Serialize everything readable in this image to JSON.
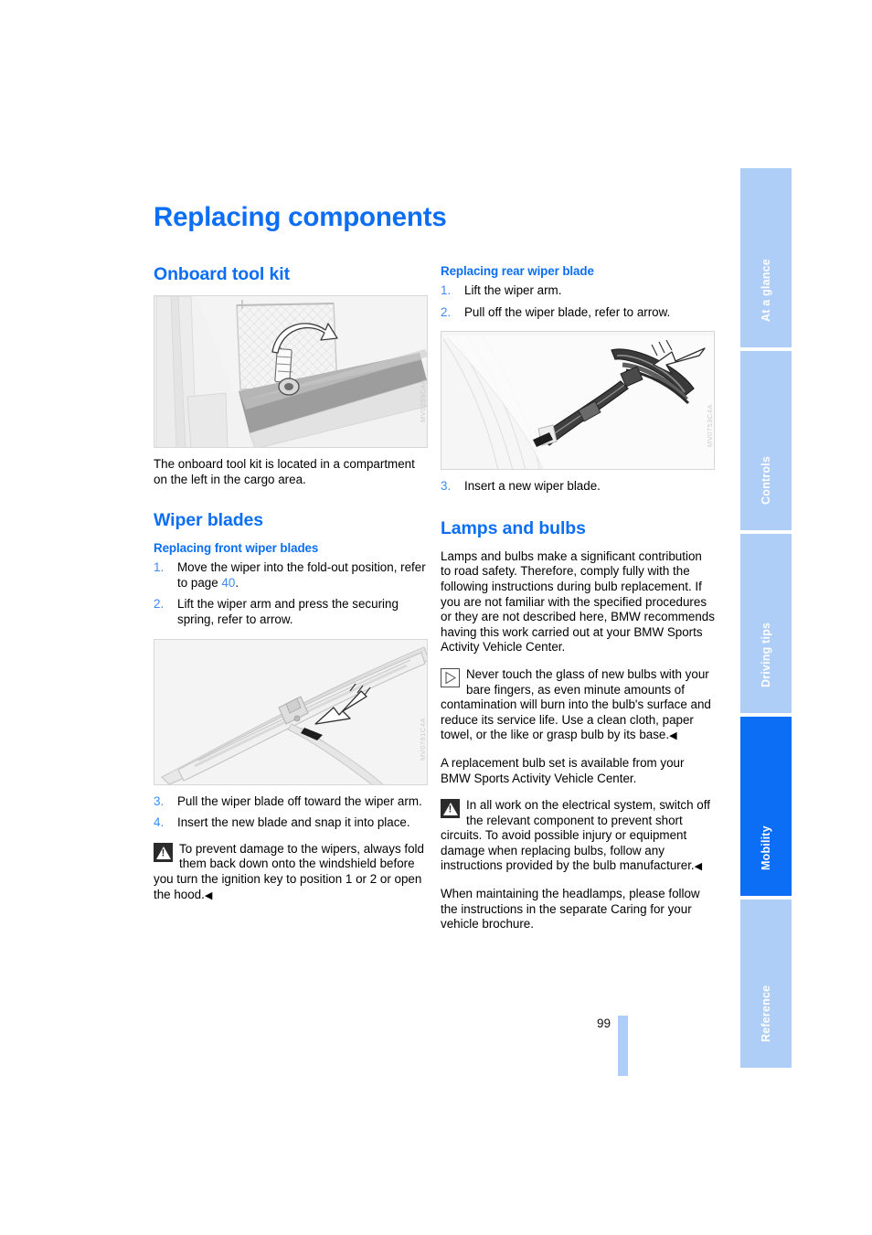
{
  "page": {
    "title": "Replacing components",
    "folio": "99",
    "accent_blue": "#0b6ef4",
    "tab_blue_inactive": "#aecdf7"
  },
  "sidebar": {
    "tabs": [
      {
        "label": "At a glance",
        "active": false
      },
      {
        "label": "Controls",
        "active": false
      },
      {
        "label": "Driving tips",
        "active": false
      },
      {
        "label": "Mobility",
        "active": true
      },
      {
        "label": "Reference",
        "active": false
      }
    ]
  },
  "left_column": {
    "section_tool_kit": {
      "heading": "Onboard tool kit",
      "figure_code": "MV0259C4A",
      "figure_alt": "cargo area left side compartment with strap and arrow",
      "body": "The onboard tool kit is located in a compartment on the left in the cargo area."
    },
    "section_wiper_blades": {
      "heading": "Wiper blades",
      "subheading": "Replacing front wiper blades",
      "steps_before": [
        {
          "num": "1.",
          "text_before": "Move the wiper into the fold-out position, refer to page ",
          "page_ref": "40",
          "text_after": "."
        },
        {
          "num": "2.",
          "text_before": "Lift the wiper arm and press the securing spring, refer to arrow.",
          "page_ref": "",
          "text_after": ""
        }
      ],
      "figure_code": "MV0781C4A",
      "figure_alt": "front wiper arm with blade and securing spring arrow",
      "steps_after": [
        {
          "num": "3.",
          "text": "Pull the wiper blade off toward the wiper arm."
        },
        {
          "num": "4.",
          "text": "Insert the new blade and snap it into place."
        }
      ],
      "warning": {
        "icon": "warning-triangle-icon",
        "text": "To prevent damage to the wipers, always fold them back down onto the windshield before you turn the ignition key to position 1 or 2 or open the hood.",
        "endmark": "◀"
      }
    }
  },
  "right_column": {
    "section_rear_wiper": {
      "subheading": "Replacing rear wiper blade",
      "steps_before": [
        {
          "num": "1.",
          "text": "Lift the wiper arm."
        },
        {
          "num": "2.",
          "text": "Pull off the wiper blade, refer to arrow."
        }
      ],
      "figure_code": "MV0753C4A",
      "figure_alt": "rear wiper blade being pulled off, arrow indicating direction",
      "steps_after": [
        {
          "num": "3.",
          "text": "Insert a new wiper blade."
        }
      ]
    },
    "section_lamps": {
      "heading": "Lamps and bulbs",
      "intro": "Lamps and bulbs make a significant contribution to road safety. Therefore, comply fully with the following instructions during bulb replacement. If you are not familiar with the specified procedures or they are not described here, BMW recommends having this work carried out at your BMW Sports Activity Vehicle Center.",
      "note": {
        "icon": "note-triangle-icon",
        "text": "Never touch the glass of new bulbs with your bare fingers, as even minute amounts of contamination will burn into the bulb's surface and reduce its service life. Use a clean cloth, paper towel, or the like or grasp bulb by its base.",
        "endmark": "◀"
      },
      "replacement_set": "A replacement bulb set is available from your BMW Sports Activity Vehicle Center.",
      "warning": {
        "icon": "warning-triangle-icon",
        "text": "In all work on the electrical system, switch off the relevant component to prevent short circuits. To avoid possible injury or equipment damage when replacing bulbs, follow any instructions provided by the bulb manufacturer.",
        "endmark": "◀"
      },
      "closing": "When maintaining the headlamps, please follow the instructions in the separate Caring for your vehicle brochure."
    }
  }
}
